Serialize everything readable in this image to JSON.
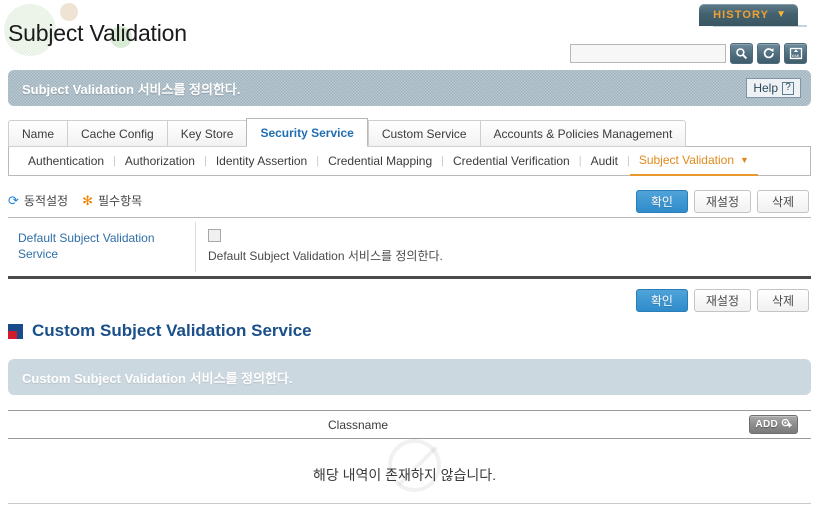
{
  "page": {
    "title": "Subject Validation",
    "banner_text": "Subject Validation 서비스를 정의한다."
  },
  "history": {
    "label": "HISTORY",
    "chevron": "▼"
  },
  "search": {
    "value": "",
    "placeholder": "",
    "buttons": [
      {
        "name": "search-icon",
        "title": "Search"
      },
      {
        "name": "refresh-icon",
        "title": "Refresh"
      },
      {
        "name": "xml-export-icon",
        "title": "XML"
      }
    ]
  },
  "help": {
    "label": "Help",
    "glyph": "?"
  },
  "tabs": [
    {
      "label": "Name",
      "active": false
    },
    {
      "label": "Cache Config",
      "active": false
    },
    {
      "label": "Key Store",
      "active": false
    },
    {
      "label": "Security Service",
      "active": true
    },
    {
      "label": "Custom Service",
      "active": false
    },
    {
      "label": "Accounts & Policies Management",
      "active": false
    }
  ],
  "subtabs": [
    {
      "label": "Authentication",
      "active": false
    },
    {
      "label": "Authorization",
      "active": false
    },
    {
      "label": "Identity Assertion",
      "active": false
    },
    {
      "label": "Credential Mapping",
      "active": false
    },
    {
      "label": "Credential Verification",
      "active": false
    },
    {
      "label": "Audit",
      "active": false
    },
    {
      "label": "Subject Validation",
      "active": true
    }
  ],
  "legend": {
    "dynamic": "동적설정",
    "required": "필수항목",
    "dynamic_icon": "⟳",
    "required_icon": "✻"
  },
  "buttons": {
    "confirm": "확인",
    "reset": "재설정",
    "delete": "삭제"
  },
  "default_service": {
    "label": "Default Subject Validation Service",
    "checked": false,
    "description": "Default Subject Validation 서비스를 정의한다."
  },
  "custom_section": {
    "heading": "Custom Subject Validation Service",
    "banner_text": "Custom Subject Validation 서비스를 정의한다.",
    "table": {
      "column": "Classname",
      "add_label": "ADD",
      "empty_message": "해당 내역이 존재하지 않습니다.",
      "rows": []
    }
  },
  "colors": {
    "accent_blue": "#2f8ccb",
    "active_tab_blue": "#1f6fb2",
    "subtab_orange": "#e08a1e",
    "history_orange": "#f0a030",
    "banner_gray": "#9fb3bf",
    "section_banner": "#ccd8e0",
    "heading_blue": "#1a4f8a"
  }
}
